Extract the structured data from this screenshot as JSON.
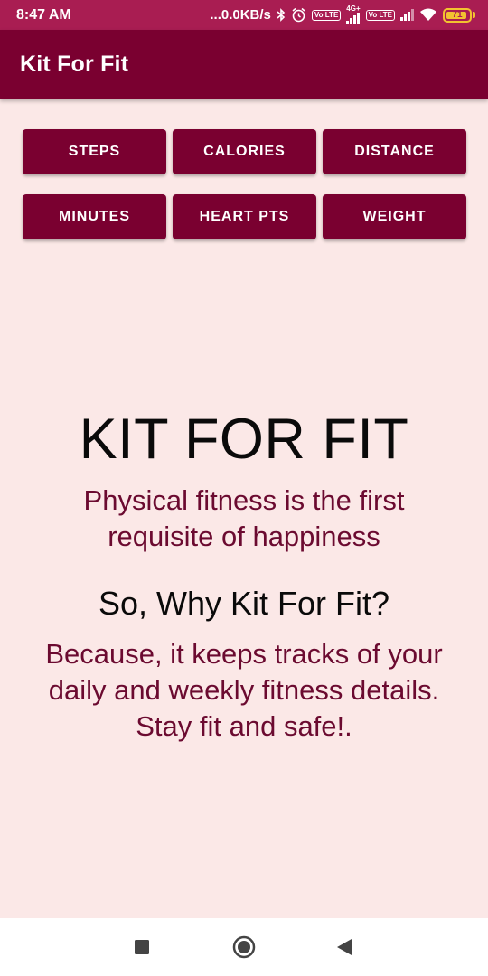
{
  "status_bar": {
    "time": "8:47 AM",
    "speed": "...0.0KB/s",
    "icons": [
      "bluetooth-icon",
      "alarm-icon",
      "volte-icon",
      "signal-4g-icon",
      "volte-icon",
      "signal-icon",
      "wifi-icon"
    ],
    "net_label": "4G+",
    "volte_label": "Vo LTE",
    "battery": "71",
    "battery_color": "#f2c230"
  },
  "app_bar": {
    "title": "Kit For Fit",
    "color": "#7a0030"
  },
  "metrics": {
    "steps": "STEPS",
    "calories": "CALORIES",
    "distance": "DISTANCE",
    "minutes": "MINUTES",
    "heart_pts": "HEART PTS",
    "weight": "WEIGHT"
  },
  "content": {
    "headline": "KIT FOR FIT",
    "tagline_line1": "Physical fitness is the first",
    "tagline_line2": "requisite of happiness",
    "why": "So, Why Kit For Fit?",
    "because_line1": "Because, it keeps tracks of your",
    "because_line2": "daily and weekly fitness details.",
    "because_line3": "Stay fit and safe!."
  },
  "nav_bar": {
    "icons": [
      "recents-square-icon",
      "home-circle-icon",
      "back-triangle-icon"
    ]
  },
  "colors": {
    "status_bar": "#a91d52",
    "background": "#fbe8e7",
    "accent": "#7a0030",
    "text_maroon": "#6b0a30"
  }
}
